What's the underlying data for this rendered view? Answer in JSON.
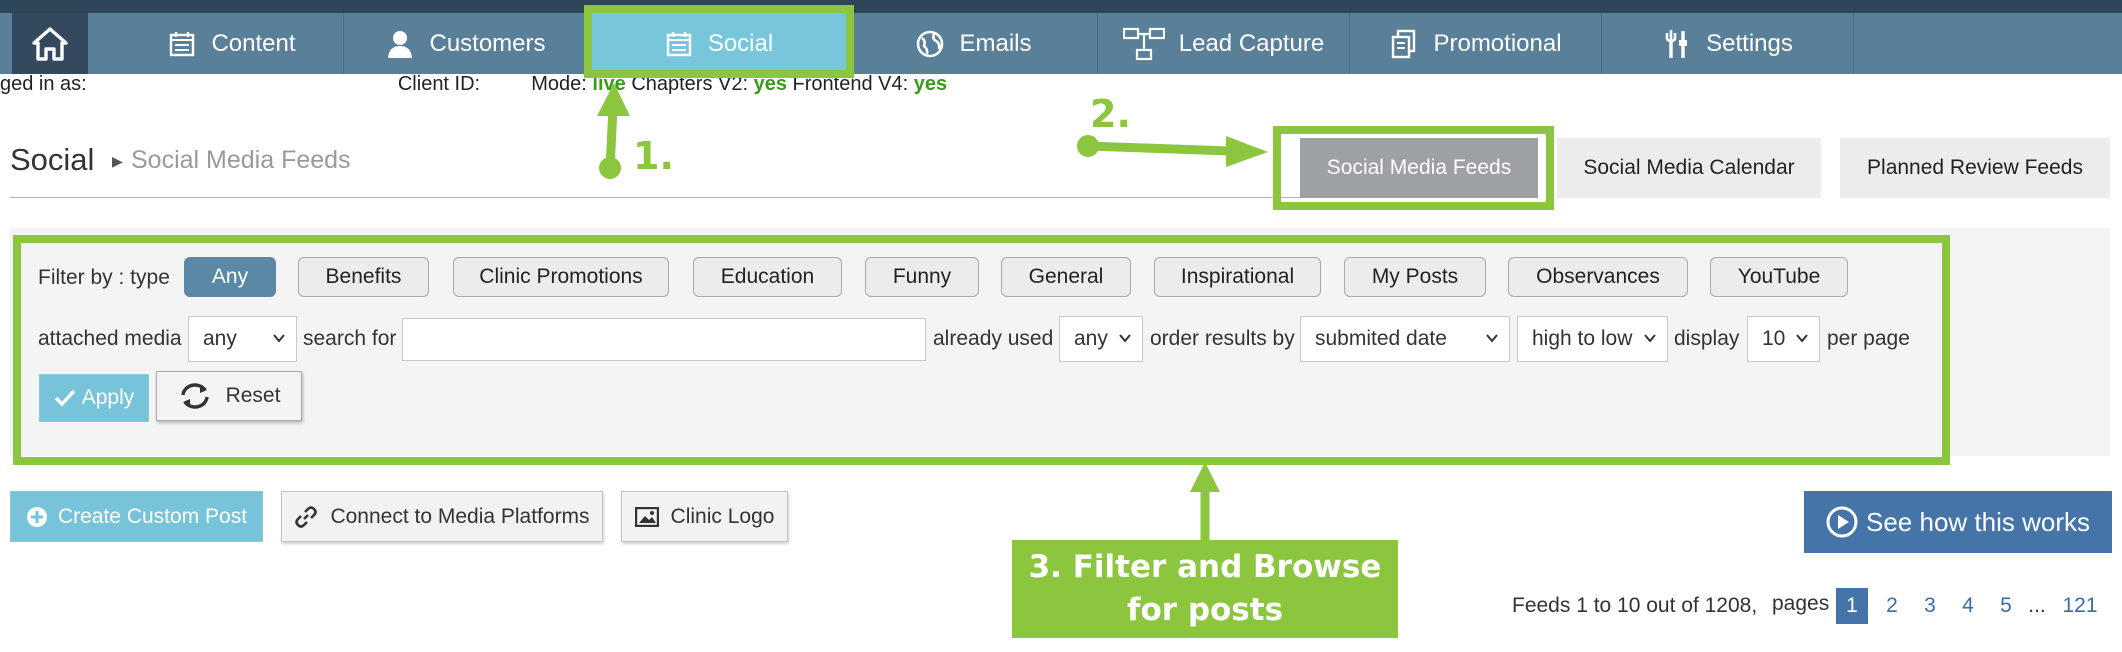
{
  "nav": {
    "items": [
      {
        "label": "Content",
        "icon": "calendar-icon"
      },
      {
        "label": "Customers",
        "icon": "person-icon"
      },
      {
        "label": "Social",
        "icon": "calendar-icon"
      },
      {
        "label": "Emails",
        "icon": "globe-icon"
      },
      {
        "label": "Lead Capture",
        "icon": "sitemap-icon"
      },
      {
        "label": "Promotional",
        "icon": "copy-icon"
      },
      {
        "label": "Settings",
        "icon": "tools-icon"
      }
    ],
    "active": "Social"
  },
  "info": {
    "logged_in": "ged in as:",
    "client_id": "Client ID:",
    "mode": "Mode:",
    "mode_value": "live",
    "chapters_label": "Chapters V2:",
    "chapters_value": "yes",
    "frontend_label": "Frontend V4:",
    "frontend_value": "yes"
  },
  "header": {
    "title": "Social",
    "crumb": "Social Media Feeds"
  },
  "tabs": [
    "Social Media Feeds",
    "Social Media Calendar",
    "Planned Review Feeds"
  ],
  "filter": {
    "label": "Filter by : type",
    "types": [
      "Any",
      "Benefits",
      "Clinic Promotions",
      "Education",
      "Funny",
      "General",
      "Inspirational",
      "My Posts",
      "Observances",
      "YouTube"
    ],
    "attached_media_label": "attached media",
    "attached_media_value": "any",
    "search_label": "search for",
    "search_value": "",
    "already_used_label": "already used",
    "already_used_value": "any",
    "order_label": "order results by",
    "order_value": "submited date",
    "direction_value": "high to low",
    "display_label": "display",
    "display_value": "10",
    "per_page_label": "per page",
    "apply_label": "Apply",
    "reset_label": "Reset"
  },
  "actions": {
    "create": "Create Custom Post",
    "connect": "Connect to Media Platforms",
    "logo": "Clinic Logo",
    "see_how": "See how this works"
  },
  "pagination": {
    "summary": "Feeds 1 to 10 out of 1208,",
    "pages_label": "pages",
    "pages": [
      "1",
      "2",
      "3",
      "4",
      "5",
      "...",
      "121"
    ],
    "current": "1"
  },
  "annotations": {
    "step1": "1.",
    "step2": "2.",
    "step3_line1": "3. Filter and Browse",
    "step3_line2": "for posts",
    "color": "#8cc63f"
  }
}
